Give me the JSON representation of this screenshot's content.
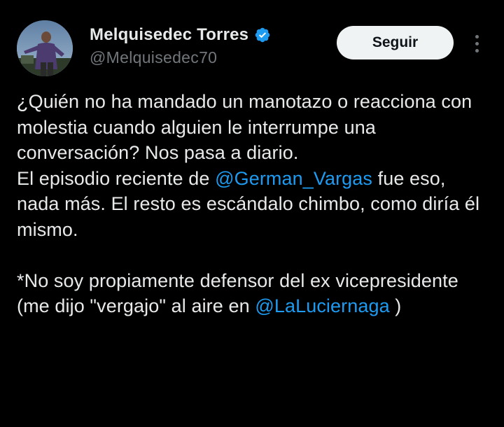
{
  "author": {
    "display_name": "Melquisedec Torres",
    "handle": "@Melquisedec70",
    "verified": true,
    "verified_color": "#1d9bf0"
  },
  "actions": {
    "follow_label": "Seguir",
    "more_icon": "more-vertical-icon"
  },
  "tweet": {
    "paragraph1": "¿Quién no ha mandado un manotazo o reacciona con molestia cuando alguien le interrumpe una conversación? Nos pasa a diario.",
    "paragraph2_before": "El episodio reciente de ",
    "mention1": "@German_Vargas",
    "paragraph2_after": " fue eso, nada más. El resto es escándalo chimbo, como diría él mismo.",
    "paragraph3_before": "*No soy propiamente defensor del ex vicepresidente (me dijo \"vergajo\" al aire en ",
    "mention2": "@LaLuciernaga",
    "paragraph3_after": " )"
  },
  "colors": {
    "background": "#000000",
    "text": "#e7e9ea",
    "secondary_text": "#71767b",
    "link": "#1d9bf0",
    "button_bg": "#eff3f4",
    "button_text": "#0f1419"
  }
}
